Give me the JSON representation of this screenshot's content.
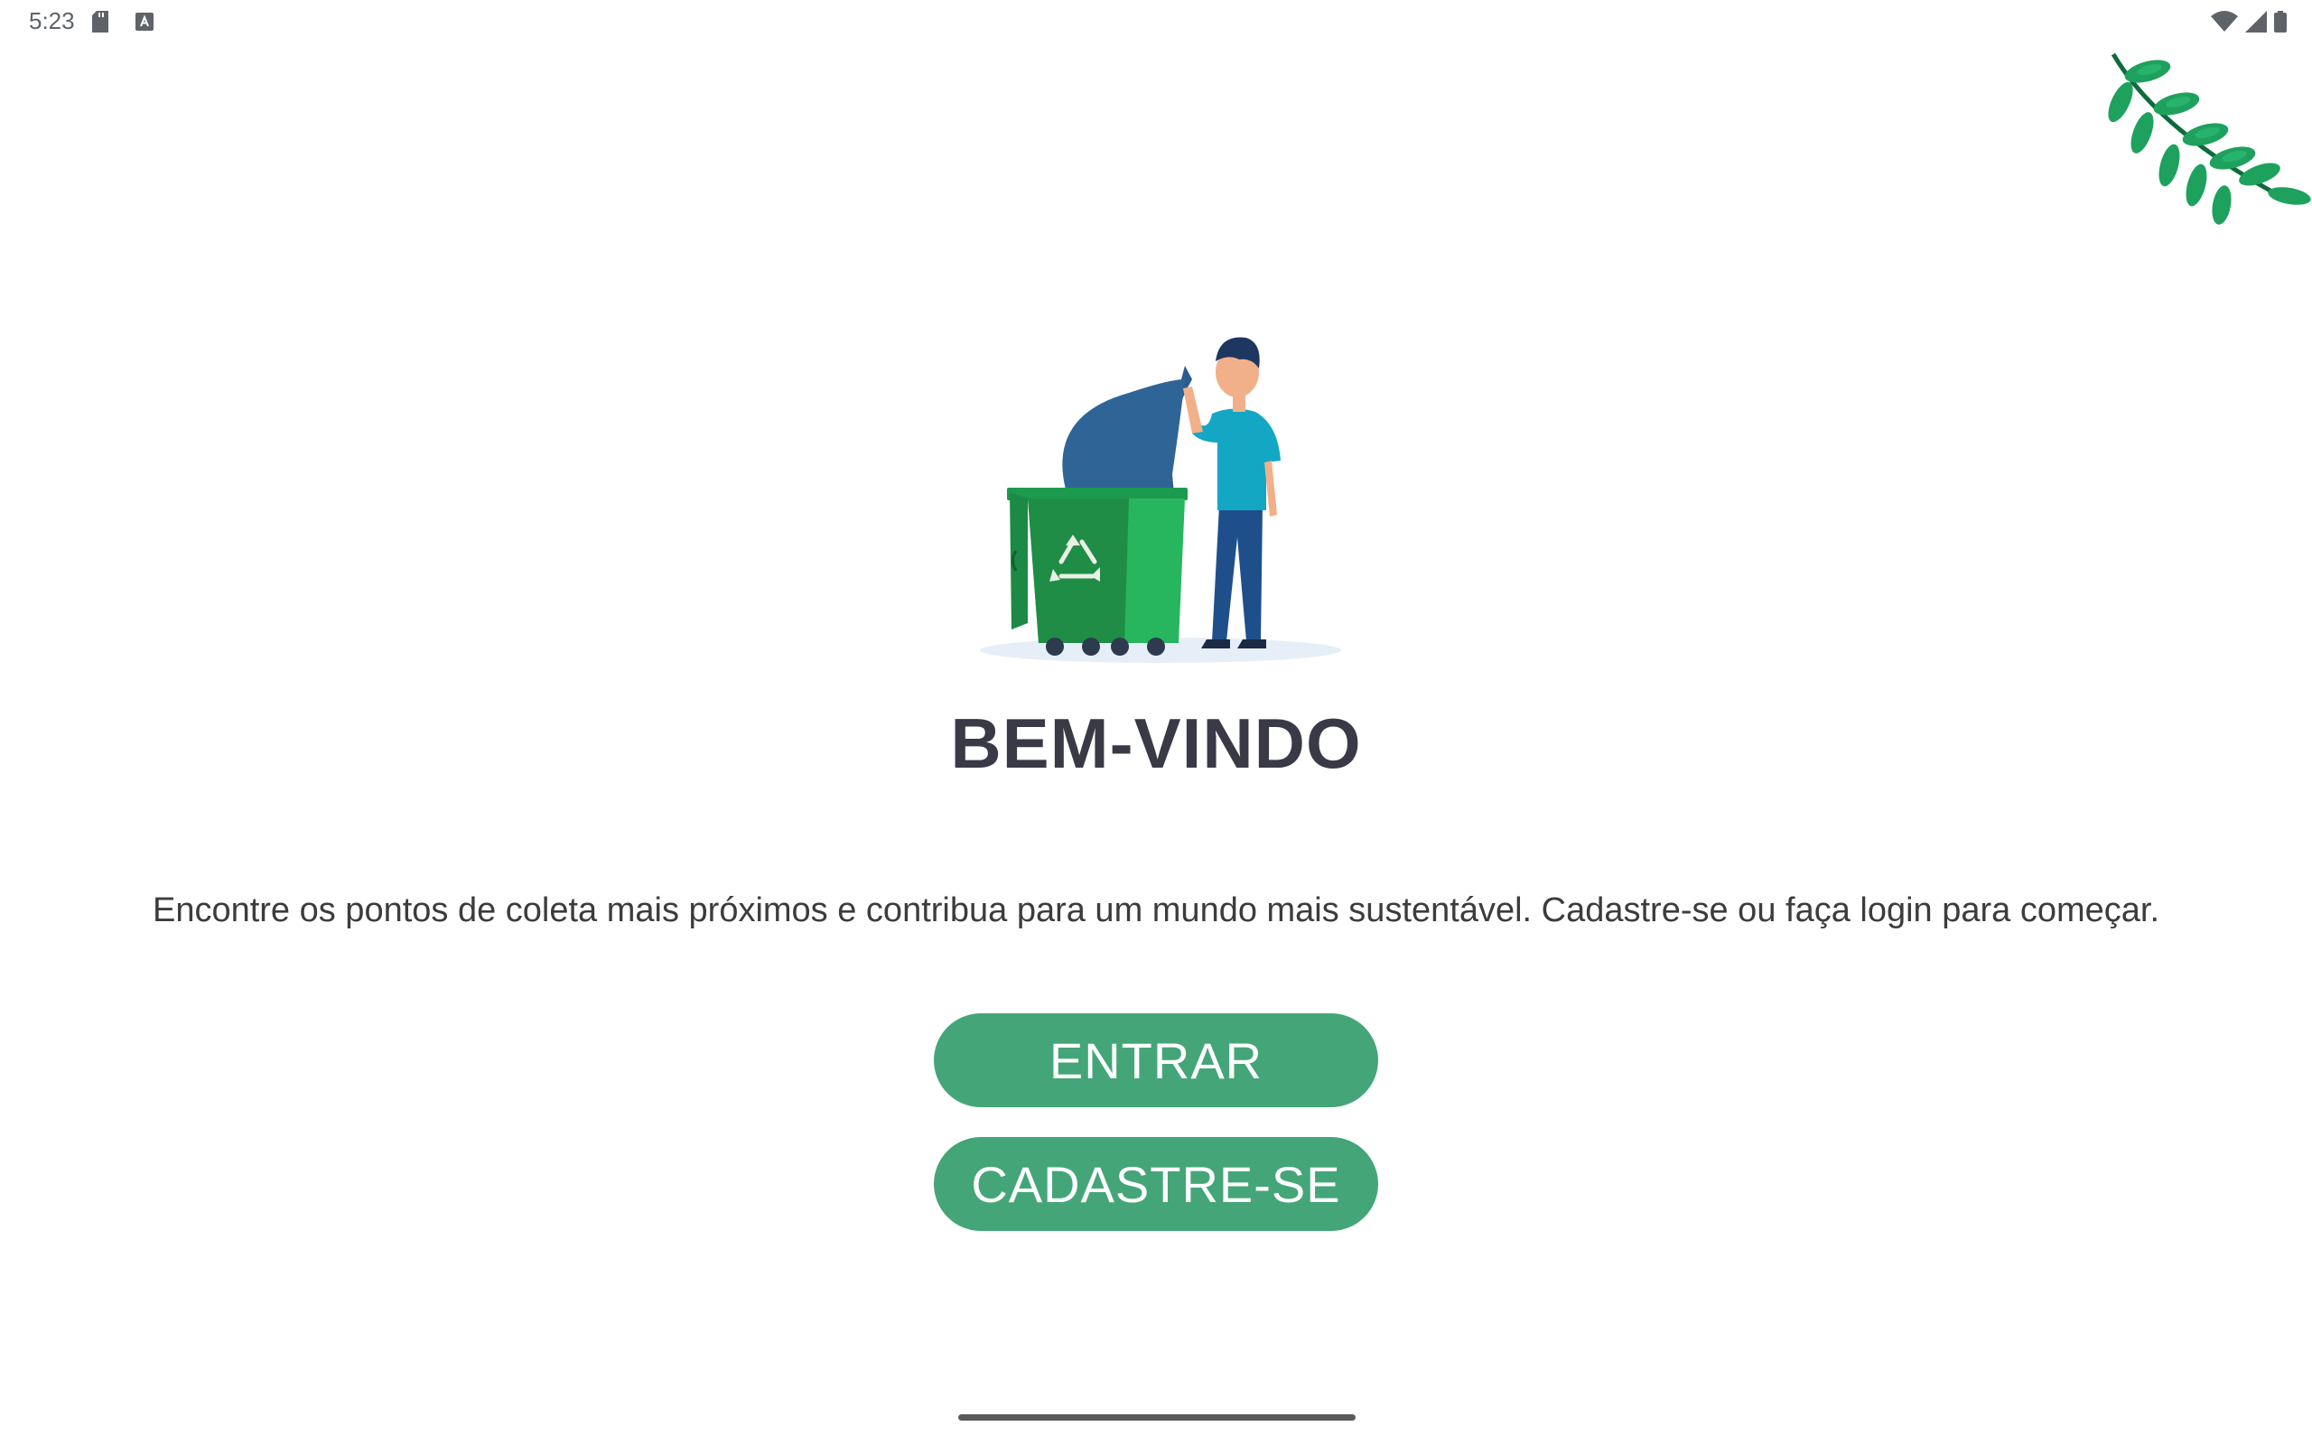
{
  "status_bar": {
    "time": "5:23",
    "icons": [
      "sd-card-icon",
      "accessibility-a-icon",
      "wifi-icon",
      "signal-icon",
      "battery-icon"
    ]
  },
  "decoration": {
    "leaves_color": "#1fa15e"
  },
  "main": {
    "title": "BEM-VINDO",
    "subtitle": "Encontre os pontos de coleta mais próximos e contribua para um mundo mais sustentável. Cadastre-se ou faça login para começar.",
    "login_button_label": "ENTRAR",
    "signup_button_label": "CADASTRE-SE"
  },
  "colors": {
    "accent": "#44a678",
    "title": "#3a3a46",
    "text": "#3c3c3c"
  }
}
